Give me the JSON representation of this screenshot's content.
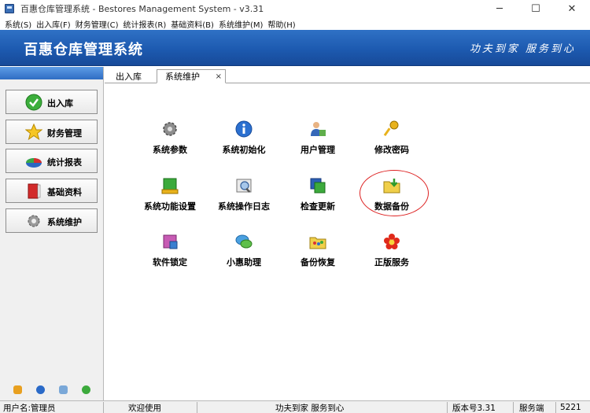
{
  "window": {
    "title": "百惠仓库管理系统 - Bestores Management System - v3.31",
    "minimize": "─",
    "maximize": "☐",
    "close": "✕"
  },
  "menu": [
    {
      "label": "系统(S)"
    },
    {
      "label": "出入库(F)"
    },
    {
      "label": "财务管理(C)"
    },
    {
      "label": "统计报表(R)"
    },
    {
      "label": "基础资料(B)"
    },
    {
      "label": "系统维护(M)"
    },
    {
      "label": "帮助(H)"
    }
  ],
  "banner": {
    "title": "百惠仓库管理系统",
    "slogan": "功夫到家 服务到心"
  },
  "sidebar": {
    "items": [
      {
        "label": "出入库",
        "icon": "check-circle-icon"
      },
      {
        "label": "财务管理",
        "icon": "star-icon"
      },
      {
        "label": "统计报表",
        "icon": "pie-chart-icon"
      },
      {
        "label": "基础资料",
        "icon": "book-icon"
      },
      {
        "label": "系统维护",
        "icon": "gear-icon"
      }
    ]
  },
  "tabs": [
    {
      "label": "出入库"
    },
    {
      "label": "系统维护",
      "close": "×"
    }
  ],
  "tiles": [
    {
      "label": "系统参数",
      "icon": "gear-icon"
    },
    {
      "label": "系统初始化",
      "icon": "info-icon"
    },
    {
      "label": "用户管理",
      "icon": "user-icon"
    },
    {
      "label": "修改密码",
      "icon": "key-icon"
    },
    {
      "label": "系统功能设置",
      "icon": "settings-panel-icon"
    },
    {
      "label": "系统操作日志",
      "icon": "log-icon"
    },
    {
      "label": "检查更新",
      "icon": "update-icon"
    },
    {
      "label": "数据备份",
      "icon": "folder-download-icon"
    },
    {
      "label": "软件锁定",
      "icon": "lock-icon"
    },
    {
      "label": "小惠助理",
      "icon": "chat-icon"
    },
    {
      "label": "备份恢复",
      "icon": "restore-icon"
    },
    {
      "label": "正版服务",
      "icon": "flower-icon"
    }
  ],
  "status": {
    "user": "用户名:管理员",
    "welcome": "欢迎使用",
    "slogan": "功夫到家 服务到心",
    "version": "版本号3.31",
    "server_label": "服务端",
    "server_value": "5221"
  },
  "colors": {
    "banner": "#1d5ab0",
    "highlight": "#dd2222"
  }
}
